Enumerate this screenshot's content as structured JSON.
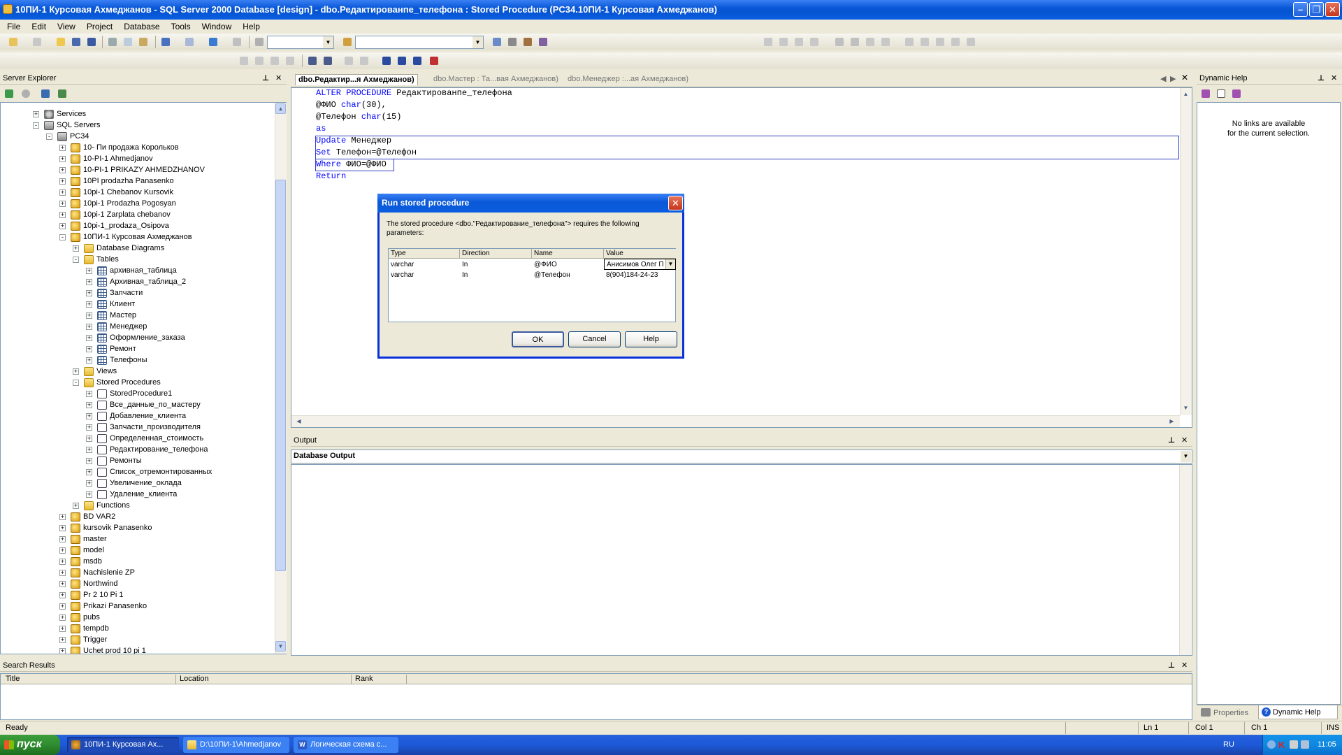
{
  "window": {
    "title": "10ПИ-1 Курсовая Ахмеджанов - SQL Server 2000 Database [design] - dbo.Редактированпе_телефона : Stored Procedure (PC34.10ПИ-1 Курсовая Ахмеджанов)",
    "buttons": [
      "minimize",
      "maximize",
      "close"
    ]
  },
  "menu": [
    "File",
    "Edit",
    "View",
    "Project",
    "Database",
    "Tools",
    "Window",
    "Help"
  ],
  "server_explorer": {
    "title": "Server Explorer",
    "tree": [
      {
        "label": "Services",
        "level": 1,
        "icon": "services-icon",
        "exp": "+"
      },
      {
        "label": "SQL Servers",
        "level": 1,
        "icon": "server-icon",
        "exp": "−"
      },
      {
        "label": "PC34",
        "level": 2,
        "icon": "server-icon",
        "exp": "−"
      },
      {
        "label": "10- Пи продажа Корольков",
        "level": 3,
        "icon": "database-icon",
        "exp": "+"
      },
      {
        "label": "10-PI-1 Ahmedjanov",
        "level": 3,
        "icon": "database-icon",
        "exp": "+"
      },
      {
        "label": "10-PI-1 PRIKAZY AHMEDZHANOV",
        "level": 3,
        "icon": "database-icon",
        "exp": "+"
      },
      {
        "label": "10PI prodazha Panasenko",
        "level": 3,
        "icon": "database-icon",
        "exp": "+"
      },
      {
        "label": "10pi-1 Chebanov Kursovik",
        "level": 3,
        "icon": "database-icon",
        "exp": "+"
      },
      {
        "label": "10pi-1 Prodazha Pogosyan",
        "level": 3,
        "icon": "database-icon",
        "exp": "+"
      },
      {
        "label": "10pi-1 Zarplata chebanov",
        "level": 3,
        "icon": "database-icon",
        "exp": "+"
      },
      {
        "label": "10pi-1_prodaza_Osipova",
        "level": 3,
        "icon": "database-icon",
        "exp": "+"
      },
      {
        "label": "10ПИ-1 Курсовая Ахмеджанов",
        "level": 3,
        "icon": "database-icon",
        "exp": "−"
      },
      {
        "label": "Database Diagrams",
        "level": 4,
        "icon": "folder-icon",
        "exp": "+"
      },
      {
        "label": "Tables",
        "level": 4,
        "icon": "folder-icon",
        "exp": "−"
      },
      {
        "label": "архивная_таблица",
        "level": 5,
        "icon": "table-icon",
        "exp": "+"
      },
      {
        "label": "Архивная_таблица_2",
        "level": 5,
        "icon": "table-icon",
        "exp": "+"
      },
      {
        "label": "Запчасти",
        "level": 5,
        "icon": "table-icon",
        "exp": "+"
      },
      {
        "label": "Клиент",
        "level": 5,
        "icon": "table-icon",
        "exp": "+"
      },
      {
        "label": "Мастер",
        "level": 5,
        "icon": "table-icon",
        "exp": "+"
      },
      {
        "label": "Менеджер",
        "level": 5,
        "icon": "table-icon",
        "exp": "+"
      },
      {
        "label": "Оформление_заказа",
        "level": 5,
        "icon": "table-icon",
        "exp": "+"
      },
      {
        "label": "Ремонт",
        "level": 5,
        "icon": "table-icon",
        "exp": "+"
      },
      {
        "label": "Телефоны",
        "level": 5,
        "icon": "table-icon",
        "exp": "+"
      },
      {
        "label": "Views",
        "level": 4,
        "icon": "folder-icon",
        "exp": "+"
      },
      {
        "label": "Stored Procedures",
        "level": 4,
        "icon": "folder-icon",
        "exp": "−"
      },
      {
        "label": "StoredProcedure1",
        "level": 5,
        "icon": "stored-procedure-icon",
        "exp": "+"
      },
      {
        "label": "Все_данные_по_мастеру",
        "level": 5,
        "icon": "stored-procedure-icon",
        "exp": "+"
      },
      {
        "label": "Добавление_клиента",
        "level": 5,
        "icon": "stored-procedure-icon",
        "exp": "+"
      },
      {
        "label": "Запчасти_производителя",
        "level": 5,
        "icon": "stored-procedure-icon",
        "exp": "+"
      },
      {
        "label": "Определенная_стоимость",
        "level": 5,
        "icon": "stored-procedure-icon",
        "exp": "+"
      },
      {
        "label": "Редактирование_телефона",
        "level": 5,
        "icon": "stored-procedure-icon",
        "exp": "+"
      },
      {
        "label": "Ремонты",
        "level": 5,
        "icon": "stored-procedure-icon",
        "exp": "+"
      },
      {
        "label": "Список_отремонтированных",
        "level": 5,
        "icon": "stored-procedure-icon",
        "exp": "+"
      },
      {
        "label": "Увеличение_оклада",
        "level": 5,
        "icon": "stored-procedure-icon",
        "exp": "+"
      },
      {
        "label": "Удаление_клиента",
        "level": 5,
        "icon": "stored-procedure-icon",
        "exp": "+"
      },
      {
        "label": "Functions",
        "level": 4,
        "icon": "folder-icon",
        "exp": "+"
      },
      {
        "label": "BD VAR2",
        "level": 3,
        "icon": "database-icon",
        "exp": "+"
      },
      {
        "label": "kursovik Panasenko",
        "level": 3,
        "icon": "database-icon",
        "exp": "+"
      },
      {
        "label": "master",
        "level": 3,
        "icon": "database-icon",
        "exp": "+"
      },
      {
        "label": "model",
        "level": 3,
        "icon": "database-icon",
        "exp": "+"
      },
      {
        "label": "msdb",
        "level": 3,
        "icon": "database-icon",
        "exp": "+"
      },
      {
        "label": "Nachislenie ZP",
        "level": 3,
        "icon": "database-icon",
        "exp": "+"
      },
      {
        "label": "Northwind",
        "level": 3,
        "icon": "database-icon",
        "exp": "+"
      },
      {
        "label": "Pr 2 10 Pi 1",
        "level": 3,
        "icon": "database-icon",
        "exp": "+"
      },
      {
        "label": "Prikazi Panasenko",
        "level": 3,
        "icon": "database-icon",
        "exp": "+"
      },
      {
        "label": "pubs",
        "level": 3,
        "icon": "database-icon",
        "exp": "+"
      },
      {
        "label": "tempdb",
        "level": 3,
        "icon": "database-icon",
        "exp": "+"
      },
      {
        "label": "Trigger",
        "level": 3,
        "icon": "database-icon",
        "exp": "+"
      },
      {
        "label": "Uchet prod 10 pi 1",
        "level": 3,
        "icon": "database-icon",
        "exp": "+"
      }
    ]
  },
  "editor": {
    "tabs": [
      {
        "label": "dbo.Редактир...я Ахмеджанов)",
        "active": true
      },
      {
        "label": "dbo.Мастер : Та...вая Ахмеджанов)",
        "active": false
      },
      {
        "label": "dbo.Менеджер :...ая Ахмеджанов)",
        "active": false
      }
    ],
    "code": [
      [
        {
          "t": "ALTER PROCEDURE ",
          "k": true
        },
        {
          "t": "Редактированпе_телефона",
          "k": false
        }
      ],
      [
        {
          "t": "@ФИО ",
          "k": false
        },
        {
          "t": "char",
          "k": true
        },
        {
          "t": "(30),",
          "k": false
        }
      ],
      [
        {
          "t": "@Телефон ",
          "k": false
        },
        {
          "t": "char",
          "k": true
        },
        {
          "t": "(15)",
          "k": false
        }
      ],
      [
        {
          "t": "as",
          "k": true
        }
      ],
      [
        {
          "t": "Update ",
          "k": true
        },
        {
          "t": "Менеджер",
          "k": false
        }
      ],
      [
        {
          "t": "Set ",
          "k": true
        },
        {
          "t": "Телефон=@Телефон",
          "k": false
        }
      ],
      [
        {
          "t": "Where ",
          "k": true
        },
        {
          "t": "ФИО=@ФИО",
          "k": false
        }
      ],
      [
        {
          "t": "Return",
          "k": true
        }
      ]
    ]
  },
  "dialog": {
    "title": "Run stored procedure",
    "message": "The stored procedure <dbo.\"Редактирование_телефона\"> requires the following parameters:",
    "columns": [
      "Type",
      "Direction",
      "Name",
      "Value"
    ],
    "rows": [
      [
        "varchar",
        "In",
        "@ФИО",
        "Анисимов Олег П"
      ],
      [
        "varchar",
        "In",
        "@Телефон",
        "8(904)184-24-23"
      ]
    ],
    "ok": "OK",
    "cancel": "Cancel",
    "help": "Help"
  },
  "output": {
    "title": "Output",
    "selector": "Database Output"
  },
  "search_results": {
    "title": "Search Results",
    "columns": [
      "Title",
      "Location",
      "Rank"
    ]
  },
  "dynamic_help": {
    "title": "Dynamic Help",
    "message_line1": "No links are available",
    "message_line2": "for the current selection.",
    "tabs": [
      "Properties",
      "Dynamic Help"
    ]
  },
  "status": {
    "ready": "Ready",
    "ln": "Ln 1",
    "col": "Col 1",
    "ch": "Ch 1",
    "ins": "INS"
  },
  "taskbar": {
    "start": "пуск",
    "tasks": [
      {
        "label": "10ПИ-1 Курсовая Ах...",
        "active": true
      },
      {
        "label": "D:\\10ПИ-1\\Ahmedjanov",
        "active": false
      },
      {
        "label": "Логическая схема с...",
        "active": false
      }
    ],
    "lang": "RU",
    "clock": "11:05"
  },
  "colors": {
    "keyword": "#0000ff",
    "xp_blue": "#0a58d8",
    "start_green": "#2f8b2f"
  }
}
